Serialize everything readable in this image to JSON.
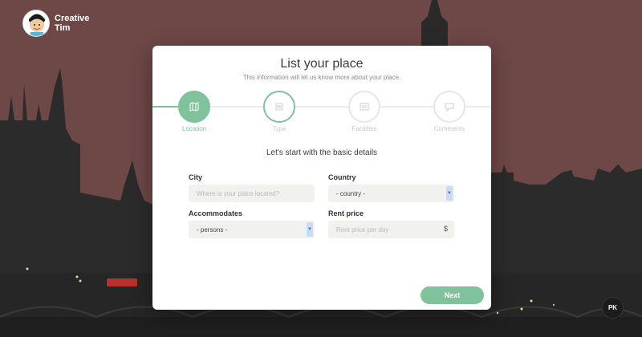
{
  "brand": {
    "name_line1": "Creative",
    "name_line2": "Tim"
  },
  "card": {
    "title": "List your place",
    "subtitle": "This information will let us know more about your place."
  },
  "wizard": {
    "steps": [
      {
        "label": "Location",
        "icon": "map-icon",
        "state": "active"
      },
      {
        "label": "Type",
        "icon": "tag-icon",
        "state": "current"
      },
      {
        "label": "Facilities",
        "icon": "building-icon",
        "state": "inactive"
      },
      {
        "label": "Comments",
        "icon": "comment-icon",
        "state": "inactive"
      }
    ]
  },
  "form": {
    "section_title": "Let's start with the basic details",
    "city": {
      "label": "City",
      "placeholder": "Where is your place located?"
    },
    "country": {
      "label": "Country",
      "value": "- country -"
    },
    "accommodates": {
      "label": "Accommodates",
      "value": "- persons -"
    },
    "rent": {
      "label": "Rent price",
      "placeholder": "Rent price per day",
      "suffix": "$"
    }
  },
  "actions": {
    "next_label": "Next"
  },
  "floating": {
    "pk_label": "PK"
  },
  "colors": {
    "accent": "#7fc29b",
    "background": "#6e4747",
    "card": "#ffffff"
  }
}
